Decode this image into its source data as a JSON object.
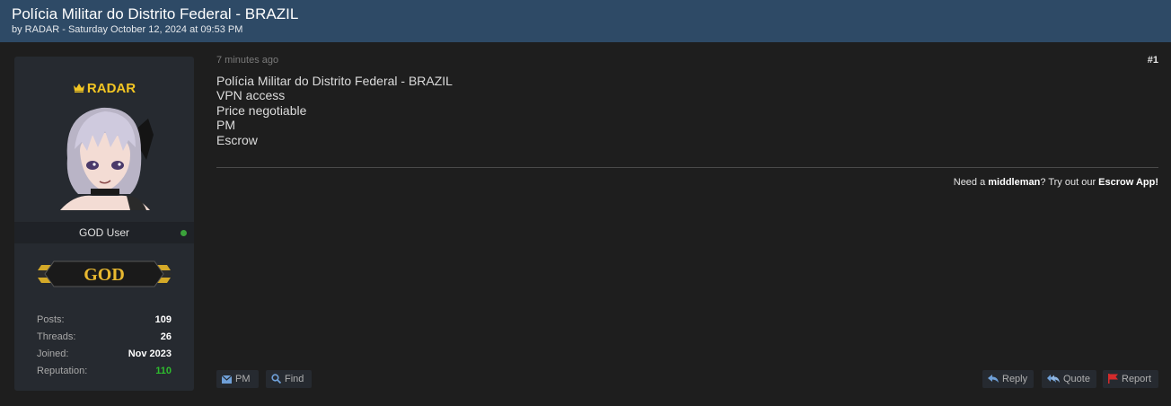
{
  "thread": {
    "title": "Polícia Militar do Distrito Federal - BRAZIL",
    "meta": "by RADAR - Saturday October 12, 2024 at 09:53 PM"
  },
  "user": {
    "name": "RADAR",
    "title": "GOD User",
    "rank_badge_text": "GOD",
    "online": true,
    "stats": [
      {
        "label": "Posts:",
        "value": "109"
      },
      {
        "label": "Threads:",
        "value": "26"
      },
      {
        "label": "Joined:",
        "value": "Nov 2023"
      },
      {
        "label": "Reputation:",
        "value": "110"
      }
    ]
  },
  "post": {
    "time": "7 minutes ago",
    "number": "#1",
    "lines": [
      "Polícia Militar do Distrito Federal - BRAZIL",
      "VPN access",
      "Price negotiable",
      "PM",
      "Escrow"
    ],
    "signature": {
      "prefix": "Need a ",
      "middleman": "middleman",
      "mid": "? Try out our ",
      "escrow": "Escrow App!"
    }
  },
  "buttons": {
    "pm": "PM",
    "find": "Find",
    "reply": "Reply",
    "quote": "Quote",
    "report": "Report"
  },
  "colors": {
    "header_bg": "#2e4a66",
    "username": "#f3c623",
    "reputation": "#2ebd2e",
    "online": "#3ba23b",
    "report_flag": "#d42b2b"
  }
}
